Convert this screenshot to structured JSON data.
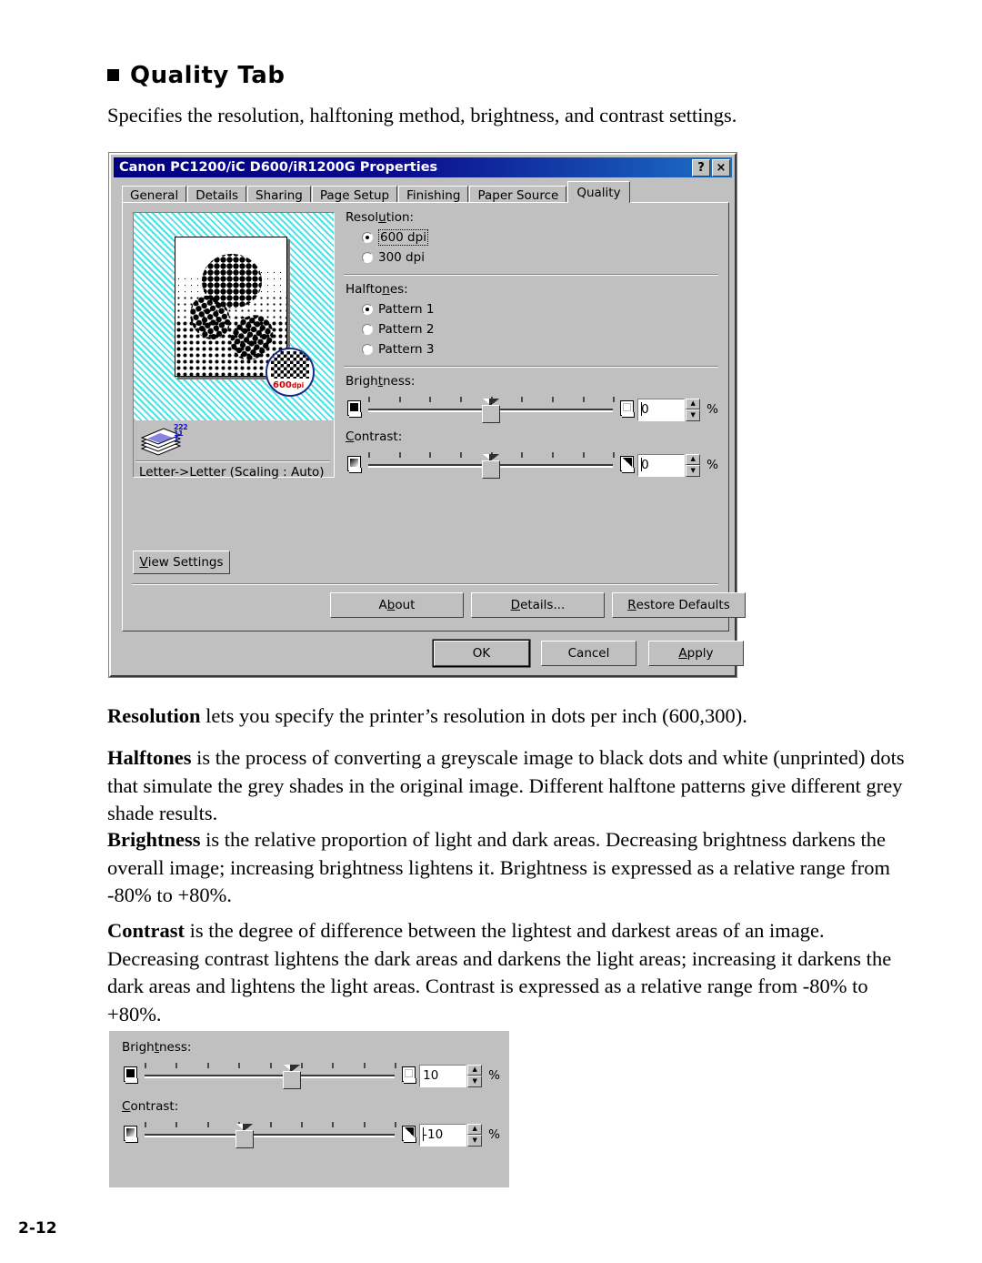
{
  "document": {
    "heading": "Quality Tab",
    "intro": "Specifies the resolution, halftoning method, brightness, and contrast settings.",
    "paragraphs": [
      {
        "term": "Resolution",
        "text": " lets you specify the printer’s resolution in dots per inch (600,300)."
      },
      {
        "term": "Halftones",
        "text": " is the process of converting a greyscale image to black dots and white (unprinted) dots that simulate the grey shades in the original image. Different halftone patterns give different grey shade results."
      },
      {
        "term": "Brightness",
        "text": " is the relative proportion of light and dark areas. Decreasing brightness darkens the overall image; increasing brightness lightens it. Brightness is expressed as a relative range from -80% to +80%."
      },
      {
        "term": "Contrast",
        "text": " is the degree of difference between the lightest and darkest areas of an image. Decreasing contrast lightens the dark areas and darkens the light areas; increasing it darkens the dark areas and lightens the light areas. Contrast is expressed as a relative range from -80% to +80%."
      }
    ],
    "page_number": "2-12"
  },
  "dialog": {
    "title": "Canon PC1200/iC D600/iR1200G Properties",
    "title_buttons": {
      "help": "?",
      "close": "×"
    },
    "tabs": [
      {
        "label": "General",
        "active": false
      },
      {
        "label": "Details",
        "active": false
      },
      {
        "label": "Sharing",
        "active": false
      },
      {
        "label": "Page Setup",
        "active": false
      },
      {
        "label": "Finishing",
        "active": false
      },
      {
        "label": "Paper Source",
        "active": false
      },
      {
        "label": "Quality",
        "active": true
      }
    ],
    "preview": {
      "magnifier_label": "600",
      "magnifier_unit": "dpi",
      "stack_numbers": "222\n11\n1",
      "caption": "Letter->Letter (Scaling : Auto)"
    },
    "resolution": {
      "label": "Resolution:",
      "options": [
        {
          "label": "600 dpi",
          "selected": true,
          "focused": true
        },
        {
          "label": "300 dpi",
          "selected": false,
          "focused": false
        }
      ]
    },
    "halftones": {
      "label": "Halftones:",
      "label_underline_index": 7,
      "options": [
        {
          "label": "Pattern 1",
          "selected": true
        },
        {
          "label": "Pattern 2",
          "selected": false
        },
        {
          "label": "Pattern 3",
          "selected": false
        }
      ]
    },
    "brightness": {
      "label": "Brightness:",
      "value": "0",
      "unit": "%",
      "slider_position_pct": 50,
      "tick_count": 9,
      "min_icon": "black-square-page-icon",
      "max_icon": "white-square-page-icon"
    },
    "contrast": {
      "label": "Contrast:",
      "value": "0",
      "unit": "%",
      "slider_position_pct": 50,
      "tick_count": 9,
      "min_icon": "gradient-page-icon",
      "max_icon": "half-black-page-icon"
    },
    "buttons": {
      "view_settings": "View Settings",
      "about": "About",
      "details": "Details...",
      "restore_defaults": "Restore Defaults",
      "ok": "OK",
      "cancel": "Cancel",
      "apply": "Apply"
    }
  },
  "bottom_panel": {
    "brightness": {
      "label": "Brightness:",
      "value": "10",
      "unit": "%",
      "slider_position_pct": 59,
      "tick_count": 9
    },
    "contrast": {
      "label": "Contrast:",
      "value": "-10",
      "unit": "%",
      "slider_position_pct": 40,
      "tick_count": 9
    }
  },
  "colors": {
    "dialog_face": "#c0c0c0",
    "titlebar_start": "#000080",
    "titlebar_end": "#1d6fc4",
    "preview_hatch": "#49e3e6",
    "magnifier_label": "#d80000",
    "stack_number": "#1414d2"
  }
}
